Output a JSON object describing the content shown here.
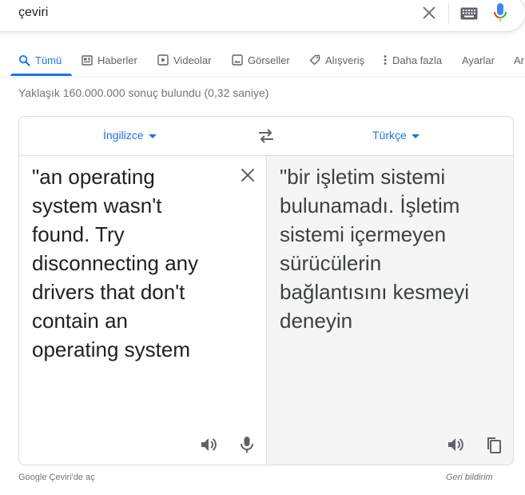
{
  "search": {
    "query": "çeviri"
  },
  "tabs": [
    {
      "label": "Tümü",
      "icon": "search-icon",
      "active": true
    },
    {
      "label": "Haberler",
      "icon": "news-icon"
    },
    {
      "label": "Videolar",
      "icon": "video-icon"
    },
    {
      "label": "Görseller",
      "icon": "image-icon"
    },
    {
      "label": "Alışveriş",
      "icon": "tag-icon"
    },
    {
      "label": "Daha fazla",
      "icon": "more-vert-icon"
    },
    {
      "label": "Ayarlar"
    },
    {
      "label": "Ar"
    }
  ],
  "result_stats": "Yaklaşık 160.000.000 sonuç bulundu (0,32 saniye)",
  "translate": {
    "source_lang": "İngilizce",
    "target_lang": "Türkçe",
    "source_lines": [
      "\"an operating",
      "system wasn't",
      "found. Try",
      "disconnecting any",
      "drivers that don't",
      "contain an",
      "operating system"
    ],
    "target_lines": [
      "\"bir işletim sistemi",
      "bulunamadı. İşletim",
      "sistemi içermeyen",
      "sürücülerin",
      "bağlantısını kesmeyi",
      "deneyin"
    ]
  },
  "footer": {
    "open_label": "Google Çeviri'de aç",
    "feedback_label": "Geri bildirim"
  },
  "colors": {
    "accent": "#1a73e8",
    "muted": "#70757a",
    "border": "#dadce0",
    "target_bg": "#f5f5f5"
  }
}
